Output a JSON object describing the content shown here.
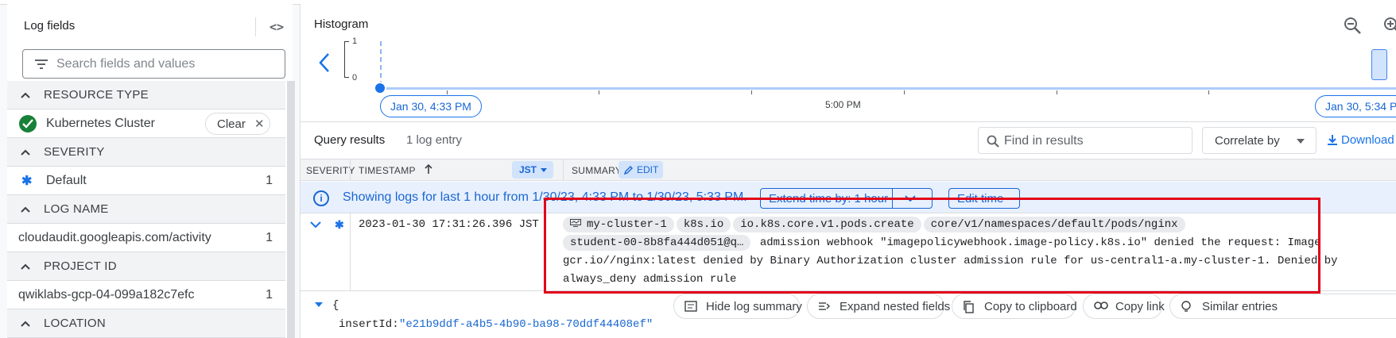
{
  "log_fields": {
    "title": "Log fields",
    "search_placeholder": "Search fields and values",
    "sections": [
      {
        "label": "RESOURCE TYPE"
      },
      {
        "label": "SEVERITY"
      },
      {
        "label": "LOG NAME"
      },
      {
        "label": "PROJECT ID"
      },
      {
        "label": "LOCATION"
      }
    ],
    "resource_value": "Kubernetes Cluster",
    "clear_label": "Clear",
    "severity_value": "Default",
    "severity_count": "1",
    "log_name_value": "cloudaudit.googleapis.com/activity",
    "log_name_count": "1",
    "project_value": "qwiklabs-gcp-04-099a182c7efc",
    "project_count": "1"
  },
  "histogram": {
    "title": "Histogram",
    "y_max": "1",
    "y_min": "0",
    "start_label": "Jan 30, 4:33 PM",
    "mid_label": "5:00 PM",
    "end_label": "Jan 30, 5:34 PM"
  },
  "query_results": {
    "title": "Query results",
    "count": "1 log entry",
    "find_placeholder": "Find in results",
    "correlate_label": "Correlate by",
    "download_label": "Download"
  },
  "columns": {
    "severity": "SEVERITY",
    "timestamp": "TIMESTAMP",
    "timezone": "JST",
    "summary": "SUMMARY",
    "edit": "EDIT"
  },
  "info": {
    "text": "Showing logs for last 1 hour from 1/30/23, 4:33 PM to 1/30/23, 5:33 PM.",
    "extend_label": "Extend time by: 1 hour",
    "edit_time_label": "Edit time"
  },
  "log_entry": {
    "timestamp": "2023-01-30 17:31:26.396 JST",
    "chips": [
      "my-cluster-1",
      "k8s.io",
      "io.k8s.core.v1.pods.create",
      "core/v1/namespaces/default/pods/nginx",
      "student-00-8b8fa444d051@q…"
    ],
    "message_part1": "admission webhook \"imagepolicywebhook.image-policy.k8s.io\" denied the request: Image",
    "message_part2": "gcr.io//nginx:latest denied by Binary Authorization cluster admission rule for us-central1-a.my-cluster-1. Denied by",
    "message_part3": "always_deny admission rule"
  },
  "json_view": {
    "open_brace": "{",
    "insert_key": "insertId:",
    "insert_value": "\"e21b9ddf-a4b5-4b90-ba98-70ddf44408ef\""
  },
  "actions": {
    "hide_summary": "Hide log summary",
    "expand_nested": "Expand nested fields",
    "copy_clipboard": "Copy to clipboard",
    "copy_link": "Copy link",
    "similar": "Similar entries"
  },
  "colors": {
    "accent": "#1a73e8",
    "success": "#188038",
    "highlight_box": "#e2001a"
  }
}
